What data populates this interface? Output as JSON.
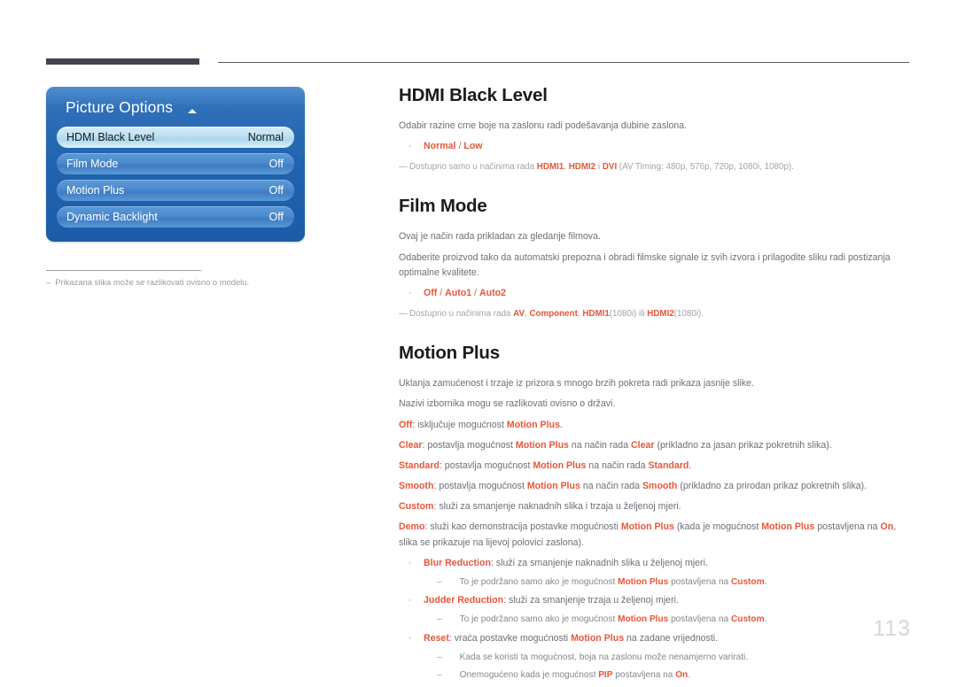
{
  "osd": {
    "title": "Picture Options",
    "caret_icon": "caret-up-icon",
    "rows": [
      {
        "label": "HDMI Black Level",
        "value": "Normal",
        "selected": true
      },
      {
        "label": "Film Mode",
        "value": "Off",
        "selected": false
      },
      {
        "label": "Motion Plus",
        "value": "Off",
        "selected": false
      },
      {
        "label": "Dynamic Backlight",
        "value": "Off",
        "selected": false
      }
    ]
  },
  "left_note": {
    "dash": "–",
    "text": "Prikazana slika može se razlikovati ovisno o modelu."
  },
  "sections": {
    "hdmi_black_level": {
      "title": "HDMI Black Level",
      "desc": "Odabir razine crne boje na zaslonu radi podešavanja dubine zaslona.",
      "bullet_marker": "·",
      "options_a": "Normal",
      "options_sep": " / ",
      "options_b": "Low",
      "note_dash": "—",
      "note_pre": "Dostupno samo u načinima rada ",
      "note_m1": "HDMI1",
      "note_c1": ", ",
      "note_m2": "HDMI2",
      "note_c2": " i ",
      "note_m3": "DVI",
      "note_tail": " (AV Timing: 480p, 576p, 720p, 1080i, 1080p)."
    },
    "film_mode": {
      "title": "Film Mode",
      "desc1": "Ovaj je način rada prikladan za gledanje filmova.",
      "desc2": "Odaberite proizvod tako da automatski prepozna i obradi filmske signale iz svih izvora i prilagodite sliku radi postizanja optimalne kvalitete.",
      "bullet_marker": "·",
      "opt1": "Off",
      "sep1": " / ",
      "opt2": "Auto1",
      "sep2": " / ",
      "opt3": "Auto2",
      "note_dash": "—",
      "note_pre": "Dostupno u načinima rada ",
      "note_m1": "AV",
      "note_c1": ", ",
      "note_m2": "Component",
      "note_c2": ", ",
      "note_m3": "HDMI1",
      "note_t3": "(1080i) ili ",
      "note_m4": "HDMI2",
      "note_tail": "(1080i)."
    },
    "motion_plus": {
      "title": "Motion Plus",
      "desc1": "Uklanja zamućenost i trzaje iz prizora s mnogo brzih pokreta radi prikaza jasnije slike.",
      "desc2": "Nazivi izbornika mogu se razlikovati ovisno o državi.",
      "off_key": "Off",
      "off_mid": ": isključuje mogućnost ",
      "off_term": "Motion Plus",
      "off_end": ".",
      "clear_key": "Clear",
      "clear_mid": ": postavlja mogućnost ",
      "clear_term": "Motion Plus",
      "clear_mid2": " na način rada ",
      "clear_mode": "Clear",
      "clear_end": " (prikladno za jasan prikaz pokretnih slika).",
      "standard_key": "Standard",
      "standard_mid": ": postavlja mogućnost ",
      "standard_term": "Motion Plus",
      "standard_mid2": " na način rada ",
      "standard_mode": "Standard",
      "standard_end": ".",
      "smooth_key": "Smooth",
      "smooth_mid": ": postavlja mogućnost ",
      "smooth_term": "Motion Plus",
      "smooth_mid2": " na način rada ",
      "smooth_mode": "Smooth",
      "smooth_end": " (prikladno za prirodan prikaz pokretnih slika).",
      "custom_key": "Custom",
      "custom_rest": ": služi za smanjenje naknadnih slika i trzaja u željenoj mjeri.",
      "demo_key": "Demo",
      "demo_mid": ": služi kao demonstracija postavke mogućnosti ",
      "demo_term1": "Motion Plus",
      "demo_mid2": " (kada je mogućnost ",
      "demo_term2": "Motion Plus",
      "demo_mid3": " postavljena na ",
      "demo_on": "On",
      "demo_end": ", slika se prikazuje na lijevoj polovici zaslona).",
      "bullet_marker": "·",
      "dash_marker": "–",
      "blur_key": "Blur Reduction",
      "blur_rest": ": služi za smanjenje naknadnih slika u željenoj mjeri.",
      "blur_sub_pre": "To je podržano samo ako je mogućnost ",
      "blur_sub_term": "Motion Plus",
      "blur_sub_mid": " postavljena na ",
      "blur_sub_val": "Custom",
      "blur_sub_end": ".",
      "judder_key": "Judder Reduction",
      "judder_rest": ": služi za smanjenje trzaja u željenoj mjeri.",
      "judder_sub_pre": "To je podržano samo ako je mogućnost ",
      "judder_sub_term": "Motion Plus",
      "judder_sub_mid": " postavljena na ",
      "judder_sub_val": "Custom",
      "judder_sub_end": ".",
      "reset_key": "Reset",
      "reset_mid": ": vraća postavke mogućnosti ",
      "reset_term": "Motion Plus",
      "reset_end": " na zadane vrijednosti.",
      "reset_sub1": "Kada se koristi ta mogućnost, boja na zaslonu može nenamjerno varirati.",
      "reset_sub2_pre": "Onemogućeno kada je mogućnost ",
      "reset_sub2_term": "PIP",
      "reset_sub2_mid": " postavljena na ",
      "reset_sub2_val": "On",
      "reset_sub2_end": "."
    }
  },
  "page_number": "113",
  "colors": {
    "accent_orange": "#e8563a",
    "osd_blue": "#1f62ae",
    "rule_dark": "#454350",
    "body_grey": "#6e6e78"
  }
}
